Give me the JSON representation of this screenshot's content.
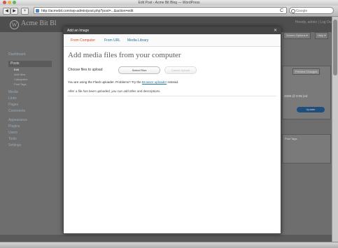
{
  "browser": {
    "window_title": "Edit Post ‹ Acme Bit Blog — WordPress",
    "url": "http://acmebit.com/wp-admin/post.php?post=...&action=edit",
    "search_placeholder": "Google",
    "reload_glyph": "C",
    "back_glyph": "◀",
    "forward_glyph": "▶",
    "add_glyph": "+"
  },
  "wp": {
    "site_title": "Acme Bit Bl",
    "logo_glyph": "W",
    "howdy": "Howdy, admin | Log Out",
    "screen_options": "Screen Options ▾",
    "help": "Help ▾",
    "menu": [
      {
        "label": "Dashboard",
        "type": "item"
      },
      {
        "label": "Posts",
        "type": "head"
      },
      {
        "label": "Edit",
        "type": "sub"
      },
      {
        "label": "Add New",
        "type": "sub"
      },
      {
        "label": "Categories",
        "type": "sub"
      },
      {
        "label": "Post Tags",
        "type": "sub"
      },
      {
        "label": "Media",
        "type": "item"
      },
      {
        "label": "Links",
        "type": "item"
      },
      {
        "label": "Pages",
        "type": "item"
      },
      {
        "label": "Comments",
        "type": "item"
      },
      {
        "label": "Appearance",
        "type": "item"
      },
      {
        "label": "Plugins",
        "type": "item"
      },
      {
        "label": "Users",
        "type": "item"
      },
      {
        "label": "Tools",
        "type": "item"
      },
      {
        "label": "Settings",
        "type": "item"
      }
    ],
    "preview_changes": "Preview Changes",
    "date_text": "2008 @ 8:05 [ed",
    "update_button": "Update",
    "post_tags": "Post Tags"
  },
  "modal": {
    "title": "Add an Image",
    "close_glyph": "✕",
    "tabs": [
      "From Computer",
      "From URL",
      "Media Library"
    ],
    "active_tab": "From Computer",
    "heading": "Add media files from your computer",
    "choose_label": "Choose files to upload",
    "select_button": "Select Files",
    "cancel_button": "Cancel Upload",
    "flash_note_prefix": "You are using the Flash uploader. Problems? Try the ",
    "flash_note_link": "Browser uploader",
    "flash_note_suffix": " instead.",
    "after_upload_note": "After a file has been uploaded, you can add titles and descriptions."
  },
  "colors": {
    "link": "#21759b",
    "active_tab": "#d54e21",
    "modal_header": "#464646"
  }
}
